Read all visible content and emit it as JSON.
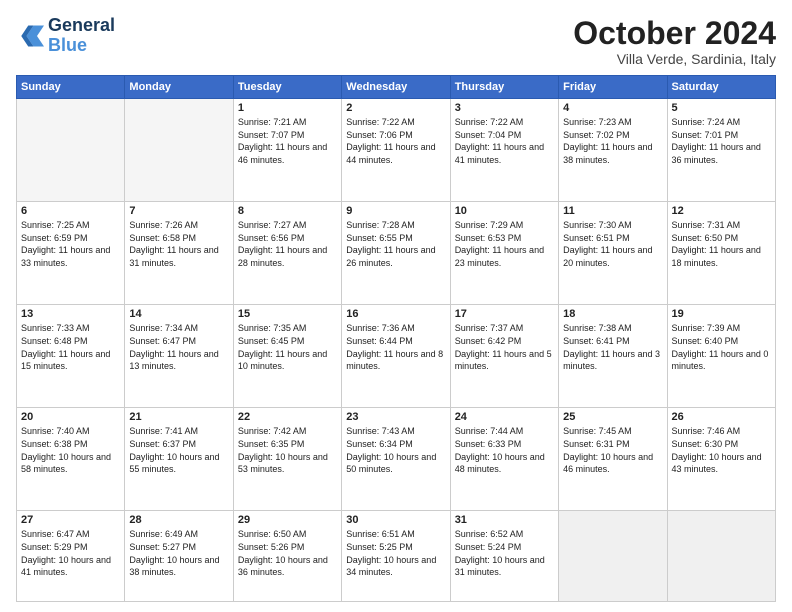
{
  "logo": {
    "line1": "General",
    "line2": "Blue"
  },
  "title": "October 2024",
  "subtitle": "Villa Verde, Sardinia, Italy",
  "weekdays": [
    "Sunday",
    "Monday",
    "Tuesday",
    "Wednesday",
    "Thursday",
    "Friday",
    "Saturday"
  ],
  "weeks": [
    [
      {
        "day": "",
        "sunrise": "",
        "sunset": "",
        "daylight": ""
      },
      {
        "day": "",
        "sunrise": "",
        "sunset": "",
        "daylight": ""
      },
      {
        "day": "1",
        "sunrise": "Sunrise: 7:21 AM",
        "sunset": "Sunset: 7:07 PM",
        "daylight": "Daylight: 11 hours and 46 minutes."
      },
      {
        "day": "2",
        "sunrise": "Sunrise: 7:22 AM",
        "sunset": "Sunset: 7:06 PM",
        "daylight": "Daylight: 11 hours and 44 minutes."
      },
      {
        "day": "3",
        "sunrise": "Sunrise: 7:22 AM",
        "sunset": "Sunset: 7:04 PM",
        "daylight": "Daylight: 11 hours and 41 minutes."
      },
      {
        "day": "4",
        "sunrise": "Sunrise: 7:23 AM",
        "sunset": "Sunset: 7:02 PM",
        "daylight": "Daylight: 11 hours and 38 minutes."
      },
      {
        "day": "5",
        "sunrise": "Sunrise: 7:24 AM",
        "sunset": "Sunset: 7:01 PM",
        "daylight": "Daylight: 11 hours and 36 minutes."
      }
    ],
    [
      {
        "day": "6",
        "sunrise": "Sunrise: 7:25 AM",
        "sunset": "Sunset: 6:59 PM",
        "daylight": "Daylight: 11 hours and 33 minutes."
      },
      {
        "day": "7",
        "sunrise": "Sunrise: 7:26 AM",
        "sunset": "Sunset: 6:58 PM",
        "daylight": "Daylight: 11 hours and 31 minutes."
      },
      {
        "day": "8",
        "sunrise": "Sunrise: 7:27 AM",
        "sunset": "Sunset: 6:56 PM",
        "daylight": "Daylight: 11 hours and 28 minutes."
      },
      {
        "day": "9",
        "sunrise": "Sunrise: 7:28 AM",
        "sunset": "Sunset: 6:55 PM",
        "daylight": "Daylight: 11 hours and 26 minutes."
      },
      {
        "day": "10",
        "sunrise": "Sunrise: 7:29 AM",
        "sunset": "Sunset: 6:53 PM",
        "daylight": "Daylight: 11 hours and 23 minutes."
      },
      {
        "day": "11",
        "sunrise": "Sunrise: 7:30 AM",
        "sunset": "Sunset: 6:51 PM",
        "daylight": "Daylight: 11 hours and 20 minutes."
      },
      {
        "day": "12",
        "sunrise": "Sunrise: 7:31 AM",
        "sunset": "Sunset: 6:50 PM",
        "daylight": "Daylight: 11 hours and 18 minutes."
      }
    ],
    [
      {
        "day": "13",
        "sunrise": "Sunrise: 7:33 AM",
        "sunset": "Sunset: 6:48 PM",
        "daylight": "Daylight: 11 hours and 15 minutes."
      },
      {
        "day": "14",
        "sunrise": "Sunrise: 7:34 AM",
        "sunset": "Sunset: 6:47 PM",
        "daylight": "Daylight: 11 hours and 13 minutes."
      },
      {
        "day": "15",
        "sunrise": "Sunrise: 7:35 AM",
        "sunset": "Sunset: 6:45 PM",
        "daylight": "Daylight: 11 hours and 10 minutes."
      },
      {
        "day": "16",
        "sunrise": "Sunrise: 7:36 AM",
        "sunset": "Sunset: 6:44 PM",
        "daylight": "Daylight: 11 hours and 8 minutes."
      },
      {
        "day": "17",
        "sunrise": "Sunrise: 7:37 AM",
        "sunset": "Sunset: 6:42 PM",
        "daylight": "Daylight: 11 hours and 5 minutes."
      },
      {
        "day": "18",
        "sunrise": "Sunrise: 7:38 AM",
        "sunset": "Sunset: 6:41 PM",
        "daylight": "Daylight: 11 hours and 3 minutes."
      },
      {
        "day": "19",
        "sunrise": "Sunrise: 7:39 AM",
        "sunset": "Sunset: 6:40 PM",
        "daylight": "Daylight: 11 hours and 0 minutes."
      }
    ],
    [
      {
        "day": "20",
        "sunrise": "Sunrise: 7:40 AM",
        "sunset": "Sunset: 6:38 PM",
        "daylight": "Daylight: 10 hours and 58 minutes."
      },
      {
        "day": "21",
        "sunrise": "Sunrise: 7:41 AM",
        "sunset": "Sunset: 6:37 PM",
        "daylight": "Daylight: 10 hours and 55 minutes."
      },
      {
        "day": "22",
        "sunrise": "Sunrise: 7:42 AM",
        "sunset": "Sunset: 6:35 PM",
        "daylight": "Daylight: 10 hours and 53 minutes."
      },
      {
        "day": "23",
        "sunrise": "Sunrise: 7:43 AM",
        "sunset": "Sunset: 6:34 PM",
        "daylight": "Daylight: 10 hours and 50 minutes."
      },
      {
        "day": "24",
        "sunrise": "Sunrise: 7:44 AM",
        "sunset": "Sunset: 6:33 PM",
        "daylight": "Daylight: 10 hours and 48 minutes."
      },
      {
        "day": "25",
        "sunrise": "Sunrise: 7:45 AM",
        "sunset": "Sunset: 6:31 PM",
        "daylight": "Daylight: 10 hours and 46 minutes."
      },
      {
        "day": "26",
        "sunrise": "Sunrise: 7:46 AM",
        "sunset": "Sunset: 6:30 PM",
        "daylight": "Daylight: 10 hours and 43 minutes."
      }
    ],
    [
      {
        "day": "27",
        "sunrise": "Sunrise: 6:47 AM",
        "sunset": "Sunset: 5:29 PM",
        "daylight": "Daylight: 10 hours and 41 minutes."
      },
      {
        "day": "28",
        "sunrise": "Sunrise: 6:49 AM",
        "sunset": "Sunset: 5:27 PM",
        "daylight": "Daylight: 10 hours and 38 minutes."
      },
      {
        "day": "29",
        "sunrise": "Sunrise: 6:50 AM",
        "sunset": "Sunset: 5:26 PM",
        "daylight": "Daylight: 10 hours and 36 minutes."
      },
      {
        "day": "30",
        "sunrise": "Sunrise: 6:51 AM",
        "sunset": "Sunset: 5:25 PM",
        "daylight": "Daylight: 10 hours and 34 minutes."
      },
      {
        "day": "31",
        "sunrise": "Sunrise: 6:52 AM",
        "sunset": "Sunset: 5:24 PM",
        "daylight": "Daylight: 10 hours and 31 minutes."
      },
      {
        "day": "",
        "sunrise": "",
        "sunset": "",
        "daylight": ""
      },
      {
        "day": "",
        "sunrise": "",
        "sunset": "",
        "daylight": ""
      }
    ]
  ]
}
